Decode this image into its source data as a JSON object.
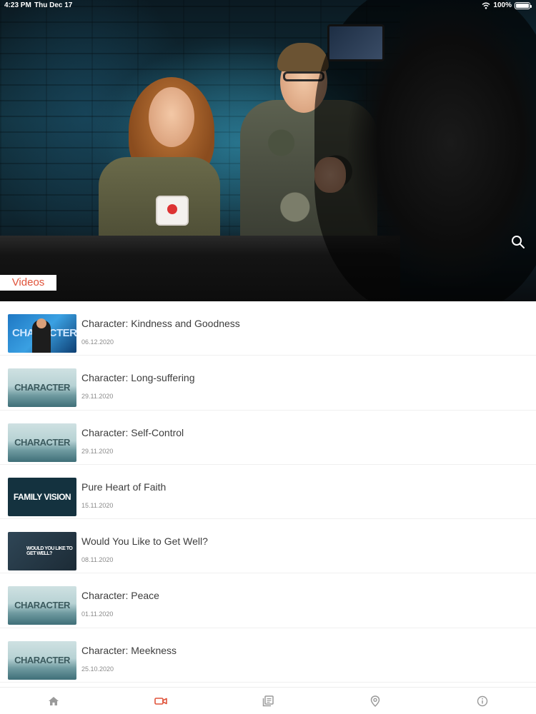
{
  "status_bar": {
    "time": "4:23 PM",
    "date": "Thu Dec 17",
    "battery": "100%"
  },
  "hero": {
    "section_label": "Videos",
    "search_icon": "search-icon"
  },
  "videos": [
    {
      "title": "Character: Kindness and Goodness",
      "date": "06.12.2020",
      "thumb_text": "CHARACTER",
      "thumb_style": "character-live"
    },
    {
      "title": "Character: Long-suffering",
      "date": "29.11.2020",
      "thumb_text": "CHARACTER",
      "thumb_style": "character"
    },
    {
      "title": "Character: Self-Control",
      "date": "29.11.2020",
      "thumb_text": "CHARACTER",
      "thumb_style": "character"
    },
    {
      "title": "Pure Heart of Faith",
      "date": "15.11.2020",
      "thumb_text": "FAMILY VISION",
      "thumb_style": "family"
    },
    {
      "title": "Would You Like to Get Well?",
      "date": "08.11.2020",
      "thumb_text": "WOULD YOU LIKE TO GET WELL?",
      "thumb_style": "getwell"
    },
    {
      "title": "Character: Peace",
      "date": "01.11.2020",
      "thumb_text": "CHARACTER",
      "thumb_style": "character"
    },
    {
      "title": "Character: Meekness",
      "date": "25.10.2020",
      "thumb_text": "CHARACTER",
      "thumb_style": "character"
    }
  ],
  "tabbar": {
    "items": [
      {
        "icon": "home-icon",
        "active": false
      },
      {
        "icon": "video-camera-icon",
        "active": true
      },
      {
        "icon": "library-icon",
        "active": false
      },
      {
        "icon": "location-pin-icon",
        "active": false
      },
      {
        "icon": "info-icon",
        "active": false
      }
    ],
    "active_color": "#e0533a",
    "inactive_color": "#9a9a9a"
  }
}
